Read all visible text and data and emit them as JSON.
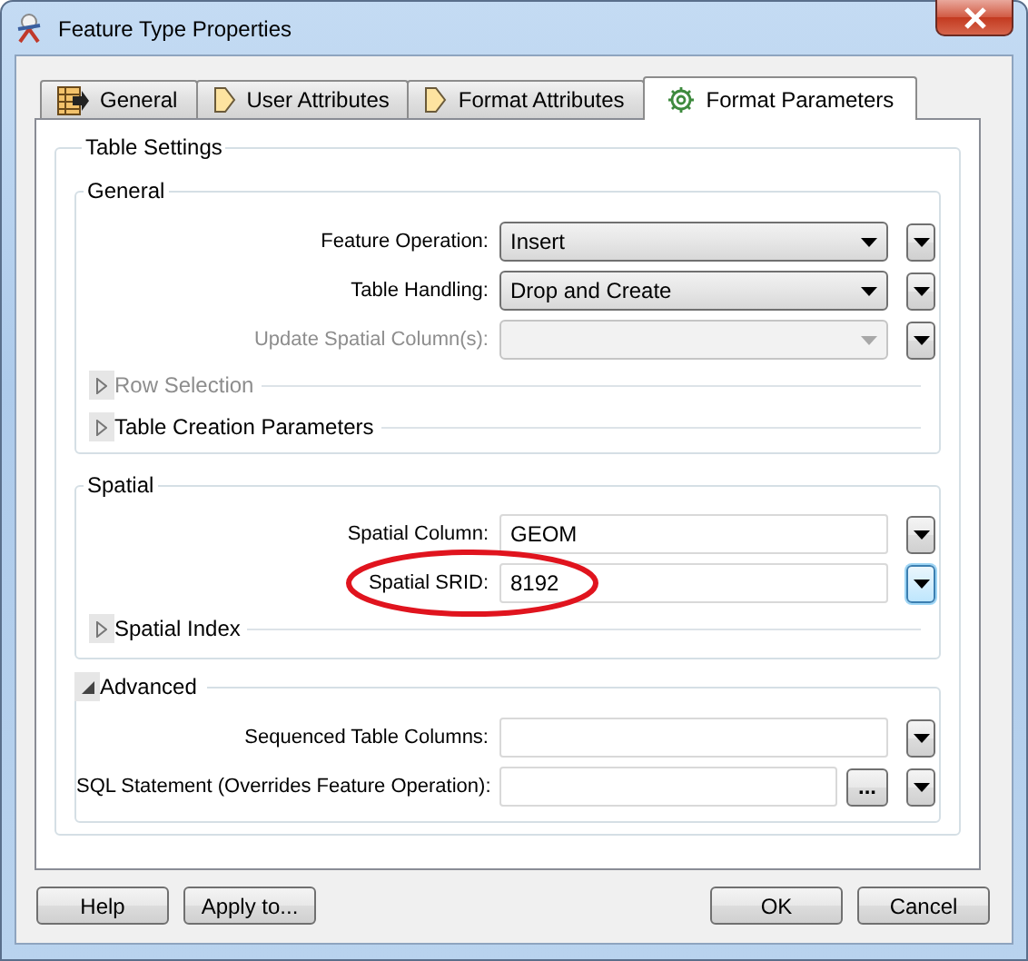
{
  "window": {
    "title": "Feature Type Properties"
  },
  "tabs": [
    {
      "label": "General",
      "selected": false
    },
    {
      "label": "User Attributes",
      "selected": false
    },
    {
      "label": "Format Attributes",
      "selected": false
    },
    {
      "label": "Format Parameters",
      "selected": true
    }
  ],
  "table_settings": {
    "title": "Table Settings",
    "sections": [
      {
        "title": "General",
        "fields": [
          {
            "label": "Feature Operation:",
            "kind": "dropdown",
            "value": "Insert",
            "disabled": false,
            "circled": false,
            "menu_focused": false
          },
          {
            "label": "Table Handling:",
            "kind": "dropdown",
            "value": "Drop and Create",
            "disabled": false,
            "circled": false,
            "menu_focused": false
          },
          {
            "label": "Update Spatial Column(s):",
            "kind": "dropdown",
            "disabled": true,
            "circled": false,
            "menu_focused": false
          }
        ],
        "groups": [
          {
            "label": "Row Selection",
            "expanded": false,
            "disabled": true
          },
          {
            "label": "Table Creation Parameters",
            "expanded": false,
            "disabled": false
          }
        ]
      },
      {
        "title": "Spatial",
        "fields": [
          {
            "label": "Spatial Column:",
            "kind": "text",
            "value": "GEOM",
            "disabled": false,
            "circled": false,
            "menu_focused": false
          },
          {
            "label": "Spatial SRID:",
            "kind": "text",
            "value": "8192",
            "disabled": false,
            "circled": true,
            "menu_focused": true
          }
        ],
        "groups": [
          {
            "label": "Spatial Index",
            "expanded": false,
            "disabled": false
          }
        ]
      }
    ],
    "advanced": {
      "title": "Advanced",
      "expanded": true,
      "fields": [
        {
          "label": "Sequenced Table Columns:",
          "kind": "text",
          "disabled": false,
          "circled": false,
          "menu_focused": false
        },
        {
          "label": "SQL Statement (Overrides Feature Operation):",
          "kind": "text",
          "browse": "...",
          "disabled": false,
          "circled": false,
          "menu_focused": false
        }
      ]
    }
  },
  "buttons": {
    "left": [
      "Help",
      "Apply to..."
    ],
    "right": [
      "OK",
      "Cancel"
    ]
  }
}
